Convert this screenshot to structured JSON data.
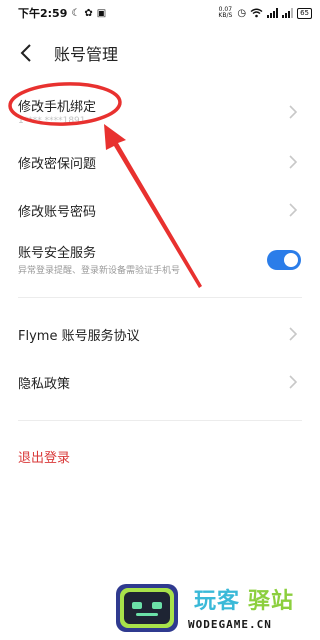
{
  "status_bar": {
    "time": "下午2:59",
    "net_speed_value": "0.07",
    "net_speed_unit": "KB/S",
    "battery": "65",
    "icons": [
      "moon-icon",
      "leaf-icon",
      "notification-icon",
      "alarm-icon",
      "wifi-icon",
      "signal-icon",
      "signal-icon",
      "battery-icon"
    ]
  },
  "header": {
    "title": "账号管理",
    "back_icon": "chevron-left-icon"
  },
  "menu": [
    {
      "label": "修改手机绑定",
      "sub": "1**** ****1891"
    },
    {
      "label": "修改密保问题"
    },
    {
      "label": "修改账号密码"
    },
    {
      "label": "账号安全服务",
      "sub": "异常登录提醒、登录新设备需验证手机号",
      "toggle_on": true
    },
    {
      "label": "Flyme 账号服务协议"
    },
    {
      "label": "隐私政策"
    }
  ],
  "logout_label": "退出登录",
  "colors": {
    "accent": "#2b7de9",
    "danger": "#d93a3a",
    "annotation": "#e8312f"
  },
  "watermark": {
    "text_1": "玩客",
    "text_2": "驿站",
    "domain": "WODEGAME.CN"
  }
}
